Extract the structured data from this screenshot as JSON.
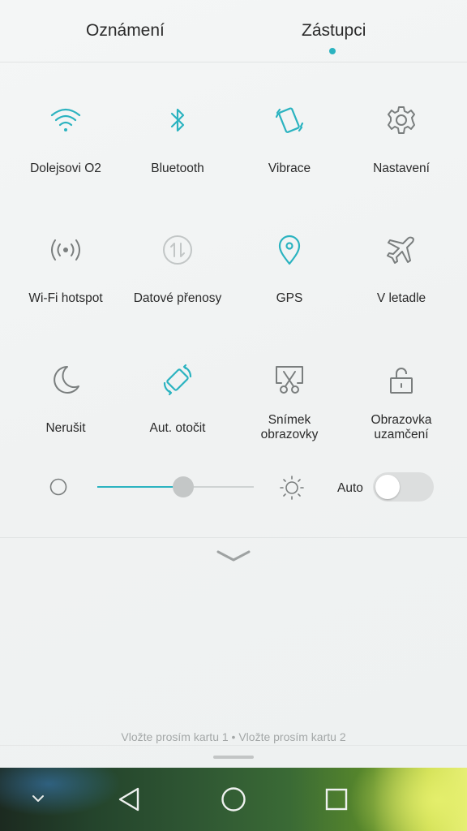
{
  "tabs": [
    {
      "label": "Oznámení",
      "active": false
    },
    {
      "label": "Zástupci",
      "active": true
    }
  ],
  "accent_color": "#2bb3c0",
  "tiles": [
    {
      "label": "Dolejsovi O2",
      "icon": "wifi-icon",
      "active": true
    },
    {
      "label": "Bluetooth",
      "icon": "bluetooth-icon",
      "active": true
    },
    {
      "label": "Vibrace",
      "icon": "vibrate-icon",
      "active": true
    },
    {
      "label": "Nastavení",
      "icon": "gear-icon",
      "active": false
    },
    {
      "label": "Wi-Fi hotspot",
      "icon": "hotspot-icon",
      "active": false
    },
    {
      "label": "Datové přenosy",
      "icon": "data-transfer-icon",
      "active": false,
      "disabled": true
    },
    {
      "label": "GPS",
      "icon": "location-pin-icon",
      "active": true
    },
    {
      "label": "V letadle",
      "icon": "airplane-icon",
      "active": false
    },
    {
      "label": "Nerušit",
      "icon": "moon-icon",
      "active": false
    },
    {
      "label": "Aut. otočit",
      "icon": "auto-rotate-icon",
      "active": true
    },
    {
      "label": "Snímek\nobrazovky",
      "line1": "Snímek",
      "line2": "obrazovky",
      "icon": "screenshot-icon",
      "active": false
    },
    {
      "label": "Obrazovka\nuzamčení",
      "line1": "Obrazovka",
      "line2": "uzamčení",
      "icon": "unlock-icon",
      "active": false
    }
  ],
  "brightness": {
    "level": 0.55,
    "min_icon": "brightness-low-icon",
    "max_icon": "brightness-high-icon",
    "auto_label": "Auto",
    "auto_enabled": false
  },
  "expand_icon": "chevron-down-icon",
  "sim_status": "Vložte prosím kartu 1 • Vložte prosím kartu 2",
  "navbar": {
    "buttons": [
      "chevron-down-icon",
      "back-icon",
      "home-icon",
      "recents-icon"
    ]
  }
}
